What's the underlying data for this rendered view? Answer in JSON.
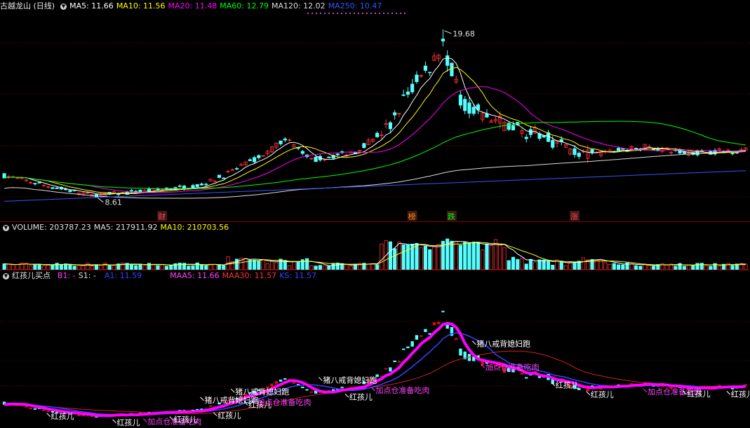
{
  "header": {
    "title": "古越龙山 (日线)",
    "ma": [
      {
        "label": "MA5: 11.66",
        "color": "#ffffff"
      },
      {
        "label": "MA10: 11.56",
        "color": "#ffff00"
      },
      {
        "label": "MA20: 11.48",
        "color": "#ff00ff"
      },
      {
        "label": "MA60: 12.79",
        "color": "#00ff00"
      },
      {
        "label": "MA120: 12.02",
        "color": "#dcdcdc"
      },
      {
        "label": "MA250: 10.47",
        "color": "#3355ff"
      }
    ]
  },
  "volume_header": {
    "label": "VOLUME: 203787.23",
    "ma5": "MA5: 217911.92",
    "ma10": "MA10: 210703.56"
  },
  "indicator_header": {
    "name": "红孩儿买点",
    "b1": "B1: -",
    "s1": "S1: -",
    "a1": "A1: 11.59",
    "maa5": "MAA5: 11.66",
    "maa30": "MAA30: 11.57",
    "ks": "KS: 11.57"
  },
  "colors": {
    "up": "#ff3232",
    "down": "#54ffff",
    "ma5": "#ffffff",
    "ma10": "#ffff00",
    "ma20": "#ff00ff",
    "ma60": "#00ff00",
    "ma120": "#dcdcdc",
    "ma250": "#3355ff",
    "indicator_main": "#ff00ff",
    "indicator_blue": "#3344ff",
    "indicator_red": "#cc2222"
  },
  "price_markers": {
    "high": "19.68",
    "low": "8.61"
  },
  "event_tags": [
    {
      "text": "财",
      "color": "#ff4444"
    },
    {
      "text": "榜",
      "color": "#ff8800"
    },
    {
      "text": "跌",
      "color": "#00ff00"
    },
    {
      "text": "涨",
      "color": "#ff4444"
    }
  ],
  "signal_labels": [
    {
      "text": "红孩儿",
      "color": "#ffffff"
    },
    {
      "text": "红孩儿",
      "color": "#ffffff"
    },
    {
      "text": "加点仓准备吃肉",
      "color": "#ff44ff"
    },
    {
      "text": "红孩儿",
      "color": "#ffffff"
    },
    {
      "text": "猪八戒背媳妇跑",
      "color": "#ffffff"
    },
    {
      "text": "红孩儿",
      "color": "#ffffff"
    },
    {
      "text": "猪八戒背媳妇跑",
      "color": "#ffffff"
    },
    {
      "text": "红孩儿",
      "color": "#ffffff"
    },
    {
      "text": "加点仓准备吃肉",
      "color": "#ff44ff"
    },
    {
      "text": "猪八戒背媳妇跑",
      "color": "#ffffff"
    },
    {
      "text": "红孩儿",
      "color": "#ffffff"
    },
    {
      "text": "加点仓准备吃肉",
      "color": "#ff44ff"
    },
    {
      "text": "猪八戒背媳妇跑",
      "color": "#ffffff"
    },
    {
      "text": "加点仓准备吃肉",
      "color": "#ff44ff"
    },
    {
      "text": "红孩儿",
      "color": "#ffffff"
    },
    {
      "text": "红孩儿",
      "color": "#ffffff"
    },
    {
      "text": "加点仓准备吃肉",
      "color": "#ff44ff"
    },
    {
      "text": "红孩儿",
      "color": "#ffffff"
    },
    {
      "text": "红孩儿",
      "color": "#ffffff"
    }
  ],
  "chart_data": {
    "type": "candlestick",
    "candles": 170,
    "price_keypoints": [
      [
        0,
        10.0
      ],
      [
        10,
        9.3
      ],
      [
        20,
        8.7
      ],
      [
        30,
        8.9
      ],
      [
        40,
        9.2
      ],
      [
        45,
        9.4
      ],
      [
        50,
        10.0
      ],
      [
        60,
        11.5
      ],
      [
        64,
        12.5
      ],
      [
        70,
        11.0
      ],
      [
        80,
        11.6
      ],
      [
        88,
        13.3
      ],
      [
        92,
        15.5
      ],
      [
        96,
        16.8
      ],
      [
        100,
        18.7
      ],
      [
        104,
        15.0
      ],
      [
        110,
        13.8
      ],
      [
        118,
        13.0
      ],
      [
        126,
        12.2
      ],
      [
        132,
        11.3
      ],
      [
        140,
        11.7
      ],
      [
        146,
        11.9
      ],
      [
        155,
        11.5
      ],
      [
        169,
        11.7
      ]
    ],
    "price_range": [
      7.9,
      20.6
    ],
    "volume_range": [
      0,
      600000
    ]
  }
}
